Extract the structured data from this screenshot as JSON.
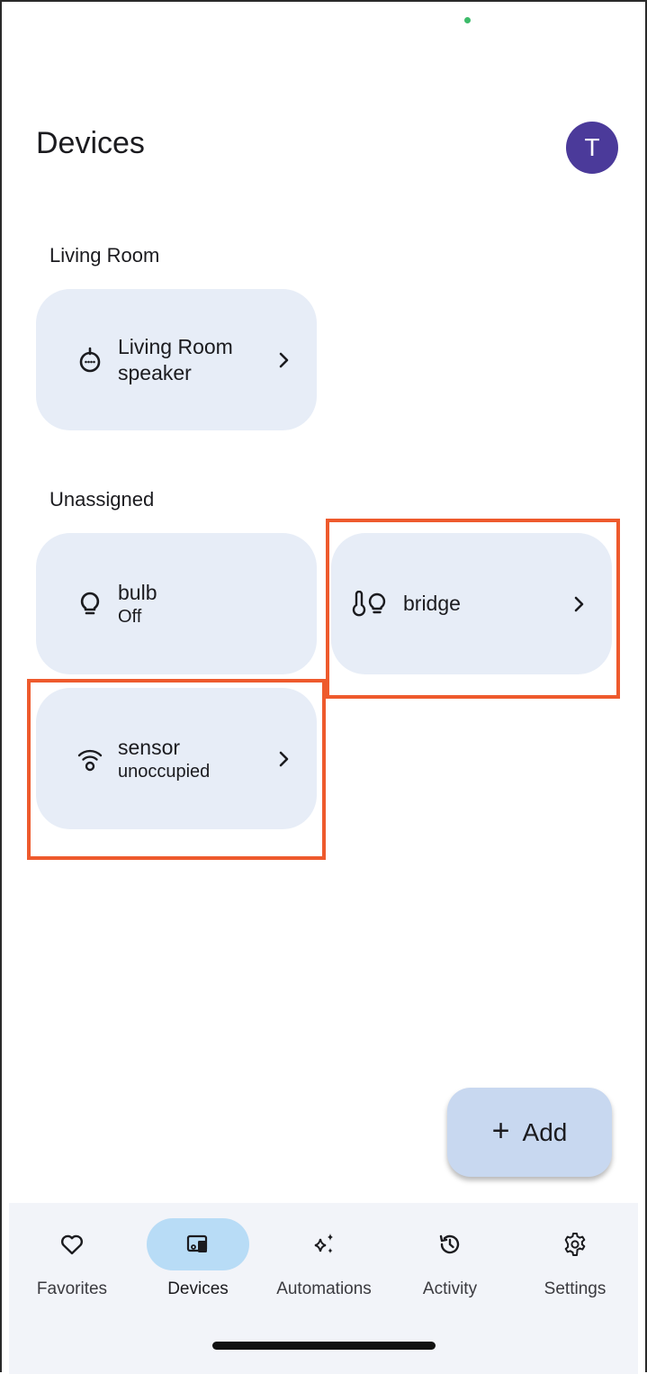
{
  "header": {
    "title": "Devices",
    "avatar_initial": "T"
  },
  "sections": [
    {
      "label": "Living Room",
      "devices": [
        {
          "name": "Living Room speaker",
          "status": "",
          "icon": "speaker-icon",
          "has_chevron": true
        }
      ]
    },
    {
      "label": "Unassigned",
      "devices": [
        {
          "name": "bulb",
          "status": "Off",
          "icon": "lightbulb-icon",
          "has_chevron": false
        },
        {
          "name": "bridge",
          "status": "",
          "icon": "thermometer-bulb-icon",
          "has_chevron": true
        },
        {
          "name": "sensor",
          "status": "unoccupied",
          "icon": "occupancy-sensor-icon",
          "has_chevron": true
        }
      ]
    }
  ],
  "fab": {
    "label": "Add",
    "icon": "plus-icon"
  },
  "bottom_nav": {
    "items": [
      {
        "label": "Favorites",
        "icon": "heart-icon",
        "active": false
      },
      {
        "label": "Devices",
        "icon": "devices-icon",
        "active": true
      },
      {
        "label": "Automations",
        "icon": "sparkle-icon",
        "active": false
      },
      {
        "label": "Activity",
        "icon": "history-icon",
        "active": false
      },
      {
        "label": "Settings",
        "icon": "gear-icon",
        "active": false
      }
    ]
  },
  "colors": {
    "card_background": "#e7edf7",
    "avatar": "#4b3a9a",
    "highlight": "#ee5a2d",
    "fab": "#c8d8f0",
    "nav_active_pill": "#b8dcf6"
  }
}
